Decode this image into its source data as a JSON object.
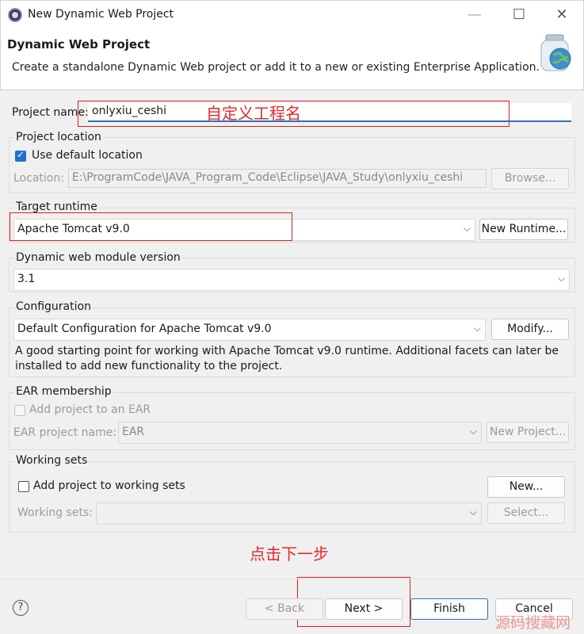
{
  "window": {
    "title": "New Dynamic Web Project",
    "minimize": "—",
    "maximize": "☐",
    "close": "✕"
  },
  "banner": {
    "title": "Dynamic Web Project",
    "description": "Create a standalone Dynamic Web project or add it to a new or existing Enterprise Application."
  },
  "project_name": {
    "label": "Project name:",
    "value": "onlyxiu_ceshi"
  },
  "location": {
    "group_label": "Project location",
    "use_default_label": "Use default location",
    "use_default_checked": true,
    "location_label": "Location:",
    "location_value": "E:\\ProgramCode\\JAVA_Program_Code\\Eclipse\\JAVA_Study\\onlyxiu_ceshi",
    "browse": "Browse..."
  },
  "target_runtime": {
    "group_label": "Target runtime",
    "value": "Apache Tomcat v9.0",
    "new_runtime": "New Runtime..."
  },
  "module_version": {
    "group_label": "Dynamic web module version",
    "value": "3.1"
  },
  "configuration": {
    "group_label": "Configuration",
    "value": "Default Configuration for Apache Tomcat v9.0",
    "modify": "Modify...",
    "desc_line1": "A good starting point for working with Apache Tomcat v9.0 runtime. Additional facets can later be",
    "desc_line2": "installed to add new functionality to the project."
  },
  "ear": {
    "group_label": "EAR membership",
    "add_label": "Add project to an EAR",
    "project_name_label": "EAR project name:",
    "project_name_value": "EAR",
    "new_project": "New Project..."
  },
  "working_sets": {
    "group_label": "Working sets",
    "add_label": "Add project to working sets",
    "new": "New...",
    "sets_label": "Working sets:",
    "select": "Select..."
  },
  "annotations": {
    "name_note": "自定义工程名",
    "next_note": "点击下一步"
  },
  "footer": {
    "help": "?",
    "back": "< Back",
    "next": "Next >",
    "finish": "Finish",
    "cancel": "Cancel"
  },
  "watermark": "源码搜藏网",
  "colors": {
    "accent": "#2f6fbf",
    "annotation": "#d9211f",
    "checkbox": "#1f6fcf"
  }
}
